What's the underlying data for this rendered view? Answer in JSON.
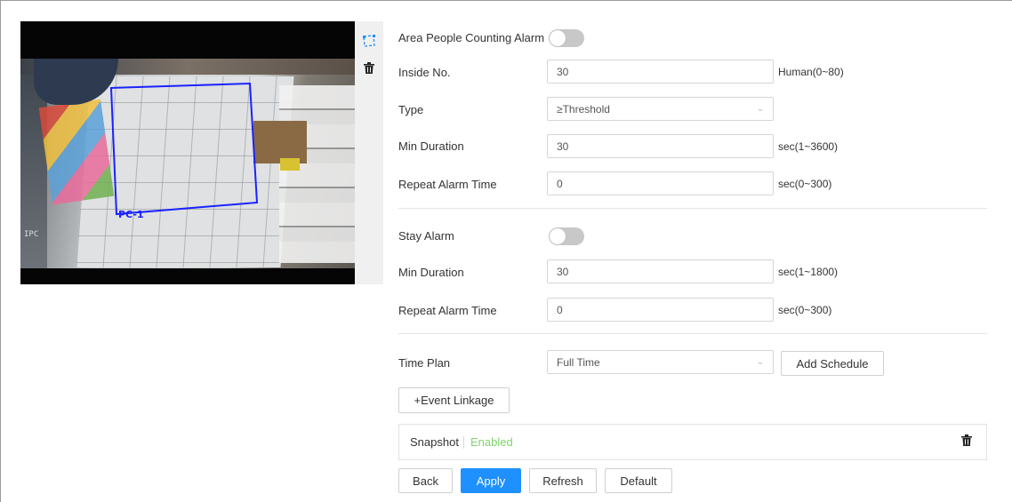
{
  "video": {
    "region_label": "PC-1",
    "osd_text": "IPC"
  },
  "toolbar": {
    "draw_icon": "draw-region-icon",
    "delete_icon": "trash-icon"
  },
  "form": {
    "area_alarm_label": "Area People Counting Alarm",
    "area_alarm_enabled": false,
    "inside_no": {
      "label": "Inside No.",
      "value": "30",
      "unit": "Human(0~80)"
    },
    "type": {
      "label": "Type",
      "value": "≥Threshold"
    },
    "min_duration_1": {
      "label": "Min Duration",
      "value": "30",
      "unit": "sec(1~3600)"
    },
    "repeat_alarm_1": {
      "label": "Repeat Alarm Time",
      "value": "0",
      "unit": "sec(0~300)"
    },
    "stay_alarm_label": "Stay Alarm",
    "stay_alarm_enabled": false,
    "min_duration_2": {
      "label": "Min Duration",
      "value": "30",
      "unit": "sec(1~1800)"
    },
    "repeat_alarm_2": {
      "label": "Repeat Alarm Time",
      "value": "0",
      "unit": "sec(0~300)"
    },
    "time_plan": {
      "label": "Time Plan",
      "value": "Full Time",
      "add_schedule": "Add Schedule"
    },
    "event_linkage_button": "+Event Linkage",
    "linkage_item": {
      "name": "Snapshot",
      "status": "Enabled"
    }
  },
  "actions": {
    "back": "Back",
    "apply": "Apply",
    "refresh": "Refresh",
    "default": "Default"
  },
  "colors": {
    "accent": "#1e90ff",
    "enabled_text": "#7ed36c",
    "region_stroke": "#1a22ff"
  }
}
